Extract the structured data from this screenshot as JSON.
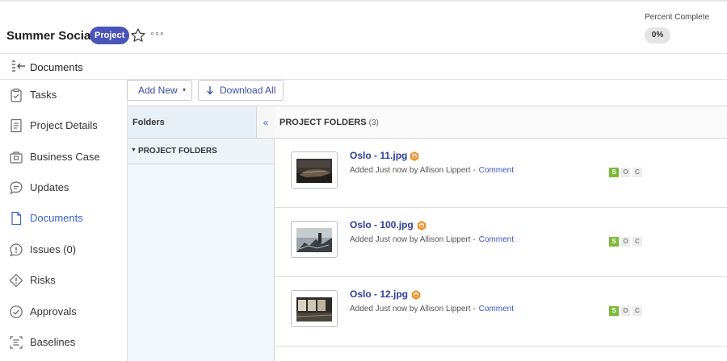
{
  "project": {
    "title": "Summer Social",
    "badge": "Project",
    "more": "◦◦◦",
    "percent_label": "Percent Complete",
    "percent_value": "0%"
  },
  "subheader": {
    "title": "Documents"
  },
  "sidebar": {
    "items": [
      {
        "label": "Tasks",
        "icon": "clipboard-check-icon"
      },
      {
        "label": "Project Details",
        "icon": "document-lines-icon"
      },
      {
        "label": "Business Case",
        "icon": "briefcase-icon"
      },
      {
        "label": "Updates",
        "icon": "chat-bubble-icon"
      },
      {
        "label": "Documents",
        "icon": "file-icon",
        "active": true
      },
      {
        "label": "Issues (0)",
        "icon": "exclamation-circle-icon"
      },
      {
        "label": "Risks",
        "icon": "diamond-exclamation-icon"
      },
      {
        "label": "Approvals",
        "icon": "check-circle-icon"
      },
      {
        "label": "Baselines",
        "icon": "baseline-icon"
      }
    ]
  },
  "toolbar": {
    "add_new": "Add New",
    "add_caret": "▾",
    "download_all": "Download All"
  },
  "folders": {
    "heading": "Folders",
    "toggle": "«",
    "root_caret": "▼",
    "root": "PROJECT FOLDERS"
  },
  "list": {
    "heading": "PROJECT FOLDERS",
    "count": "(3)",
    "documents": [
      {
        "name": "Oslo - 11.jpg",
        "added": "Added Just now by Allison Lippert -",
        "comment": "Comment",
        "soc": [
          "S",
          "O",
          "C"
        ]
      },
      {
        "name": "Oslo - 100.jpg",
        "added": "Added Just now by Allison Lippert -",
        "comment": "Comment",
        "soc": [
          "S",
          "O",
          "C"
        ]
      },
      {
        "name": "Oslo - 12.jpg",
        "added": "Added Just now by Allison Lippert -",
        "comment": "Comment",
        "soc": [
          "S",
          "O",
          "C"
        ]
      }
    ]
  },
  "colors": {
    "accent": "#3b63c9",
    "badge": "#4b54b9",
    "status_green": "#7dba3a",
    "award_orange": "#f0902a"
  }
}
